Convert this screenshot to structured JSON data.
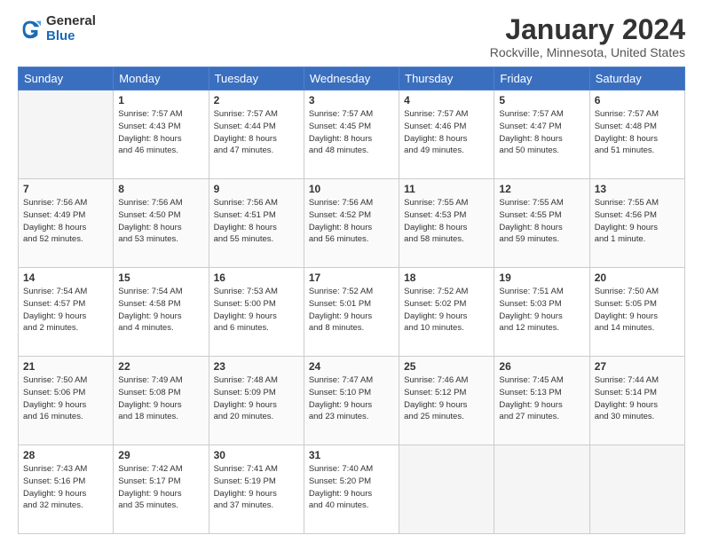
{
  "logo": {
    "general": "General",
    "blue": "Blue"
  },
  "title": "January 2024",
  "location": "Rockville, Minnesota, United States",
  "days_of_week": [
    "Sunday",
    "Monday",
    "Tuesday",
    "Wednesday",
    "Thursday",
    "Friday",
    "Saturday"
  ],
  "weeks": [
    [
      {
        "day": "",
        "info": ""
      },
      {
        "day": "1",
        "info": "Sunrise: 7:57 AM\nSunset: 4:43 PM\nDaylight: 8 hours\nand 46 minutes."
      },
      {
        "day": "2",
        "info": "Sunrise: 7:57 AM\nSunset: 4:44 PM\nDaylight: 8 hours\nand 47 minutes."
      },
      {
        "day": "3",
        "info": "Sunrise: 7:57 AM\nSunset: 4:45 PM\nDaylight: 8 hours\nand 48 minutes."
      },
      {
        "day": "4",
        "info": "Sunrise: 7:57 AM\nSunset: 4:46 PM\nDaylight: 8 hours\nand 49 minutes."
      },
      {
        "day": "5",
        "info": "Sunrise: 7:57 AM\nSunset: 4:47 PM\nDaylight: 8 hours\nand 50 minutes."
      },
      {
        "day": "6",
        "info": "Sunrise: 7:57 AM\nSunset: 4:48 PM\nDaylight: 8 hours\nand 51 minutes."
      }
    ],
    [
      {
        "day": "7",
        "info": "Sunrise: 7:56 AM\nSunset: 4:49 PM\nDaylight: 8 hours\nand 52 minutes."
      },
      {
        "day": "8",
        "info": "Sunrise: 7:56 AM\nSunset: 4:50 PM\nDaylight: 8 hours\nand 53 minutes."
      },
      {
        "day": "9",
        "info": "Sunrise: 7:56 AM\nSunset: 4:51 PM\nDaylight: 8 hours\nand 55 minutes."
      },
      {
        "day": "10",
        "info": "Sunrise: 7:56 AM\nSunset: 4:52 PM\nDaylight: 8 hours\nand 56 minutes."
      },
      {
        "day": "11",
        "info": "Sunrise: 7:55 AM\nSunset: 4:53 PM\nDaylight: 8 hours\nand 58 minutes."
      },
      {
        "day": "12",
        "info": "Sunrise: 7:55 AM\nSunset: 4:55 PM\nDaylight: 8 hours\nand 59 minutes."
      },
      {
        "day": "13",
        "info": "Sunrise: 7:55 AM\nSunset: 4:56 PM\nDaylight: 9 hours\nand 1 minute."
      }
    ],
    [
      {
        "day": "14",
        "info": "Sunrise: 7:54 AM\nSunset: 4:57 PM\nDaylight: 9 hours\nand 2 minutes."
      },
      {
        "day": "15",
        "info": "Sunrise: 7:54 AM\nSunset: 4:58 PM\nDaylight: 9 hours\nand 4 minutes."
      },
      {
        "day": "16",
        "info": "Sunrise: 7:53 AM\nSunset: 5:00 PM\nDaylight: 9 hours\nand 6 minutes."
      },
      {
        "day": "17",
        "info": "Sunrise: 7:52 AM\nSunset: 5:01 PM\nDaylight: 9 hours\nand 8 minutes."
      },
      {
        "day": "18",
        "info": "Sunrise: 7:52 AM\nSunset: 5:02 PM\nDaylight: 9 hours\nand 10 minutes."
      },
      {
        "day": "19",
        "info": "Sunrise: 7:51 AM\nSunset: 5:03 PM\nDaylight: 9 hours\nand 12 minutes."
      },
      {
        "day": "20",
        "info": "Sunrise: 7:50 AM\nSunset: 5:05 PM\nDaylight: 9 hours\nand 14 minutes."
      }
    ],
    [
      {
        "day": "21",
        "info": "Sunrise: 7:50 AM\nSunset: 5:06 PM\nDaylight: 9 hours\nand 16 minutes."
      },
      {
        "day": "22",
        "info": "Sunrise: 7:49 AM\nSunset: 5:08 PM\nDaylight: 9 hours\nand 18 minutes."
      },
      {
        "day": "23",
        "info": "Sunrise: 7:48 AM\nSunset: 5:09 PM\nDaylight: 9 hours\nand 20 minutes."
      },
      {
        "day": "24",
        "info": "Sunrise: 7:47 AM\nSunset: 5:10 PM\nDaylight: 9 hours\nand 23 minutes."
      },
      {
        "day": "25",
        "info": "Sunrise: 7:46 AM\nSunset: 5:12 PM\nDaylight: 9 hours\nand 25 minutes."
      },
      {
        "day": "26",
        "info": "Sunrise: 7:45 AM\nSunset: 5:13 PM\nDaylight: 9 hours\nand 27 minutes."
      },
      {
        "day": "27",
        "info": "Sunrise: 7:44 AM\nSunset: 5:14 PM\nDaylight: 9 hours\nand 30 minutes."
      }
    ],
    [
      {
        "day": "28",
        "info": "Sunrise: 7:43 AM\nSunset: 5:16 PM\nDaylight: 9 hours\nand 32 minutes."
      },
      {
        "day": "29",
        "info": "Sunrise: 7:42 AM\nSunset: 5:17 PM\nDaylight: 9 hours\nand 35 minutes."
      },
      {
        "day": "30",
        "info": "Sunrise: 7:41 AM\nSunset: 5:19 PM\nDaylight: 9 hours\nand 37 minutes."
      },
      {
        "day": "31",
        "info": "Sunrise: 7:40 AM\nSunset: 5:20 PM\nDaylight: 9 hours\nand 40 minutes."
      },
      {
        "day": "",
        "info": ""
      },
      {
        "day": "",
        "info": ""
      },
      {
        "day": "",
        "info": ""
      }
    ]
  ]
}
